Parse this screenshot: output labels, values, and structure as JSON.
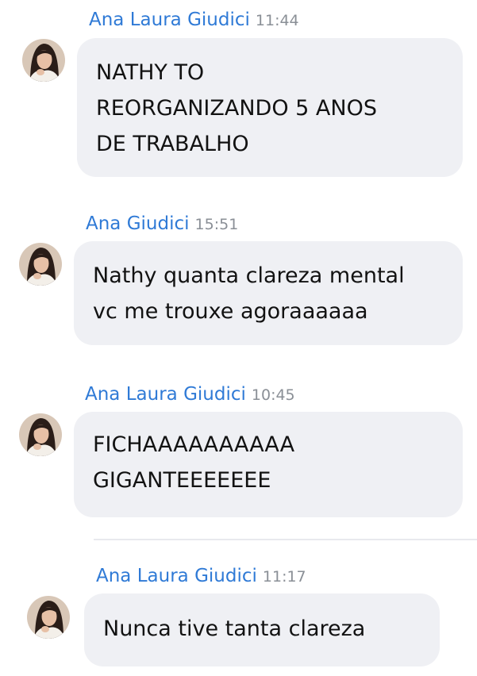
{
  "messages": [
    {
      "sender": "Ana Laura Giudici",
      "time": "11:44",
      "lines": [
        "NATHY TO",
        "REORGANIZANDO 5 ANOS",
        "DE TRABALHO"
      ]
    },
    {
      "sender": "Ana Giudici",
      "time": "15:51",
      "lines": [
        "Nathy quanta clareza mental",
        "vc me trouxe agoraaaaaa"
      ]
    },
    {
      "sender": "Ana Laura Giudici",
      "time": "10:45",
      "lines": [
        "FICHAAAAAAAAAA",
        "GIGANTEEEEEEE"
      ]
    },
    {
      "sender": "Ana Laura Giudici",
      "time": "11:17",
      "lines": [
        "Nunca tive tanta clareza"
      ]
    }
  ],
  "colors": {
    "sender": "#2f7ad6",
    "time": "#8a8f96",
    "bubble": "#eff0f4",
    "text": "#121212"
  },
  "icons": {
    "avatar": "profile-photo-avatar"
  }
}
